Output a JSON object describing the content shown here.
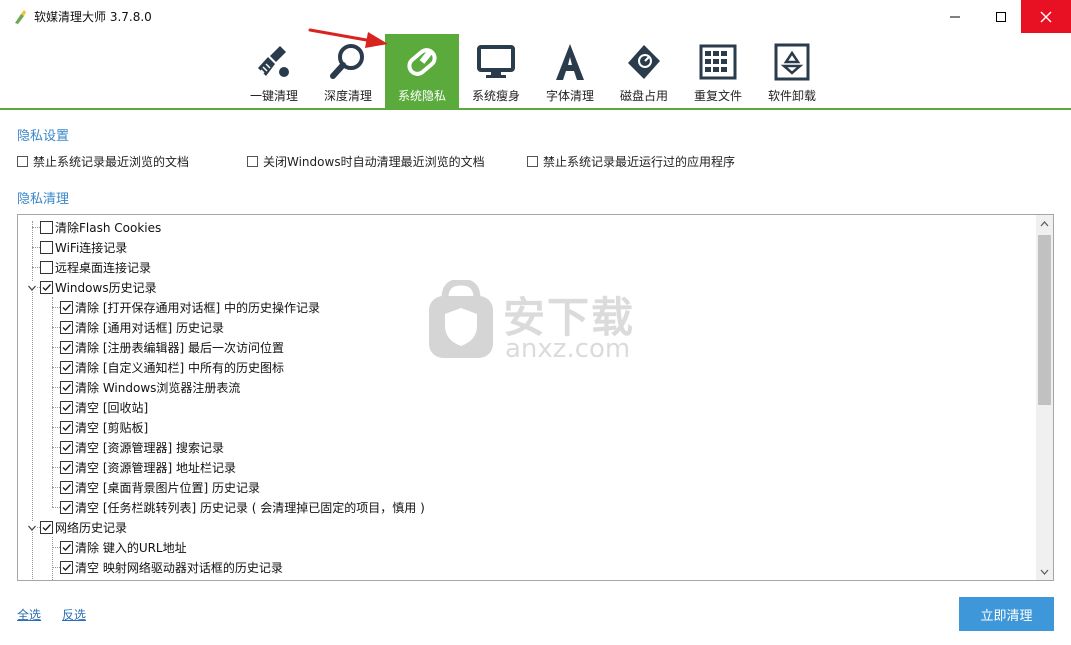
{
  "window": {
    "title": "软媒清理大师 3.7.8.0"
  },
  "toolbar": {
    "tabs": [
      {
        "label": "一键清理",
        "icon": "broom-icon"
      },
      {
        "label": "深度清理",
        "icon": "magnifier-icon"
      },
      {
        "label": "系统隐私",
        "icon": "eraser-icon",
        "active": true
      },
      {
        "label": "系统瘦身",
        "icon": "monitor-icon"
      },
      {
        "label": "字体清理",
        "icon": "font-a-icon"
      },
      {
        "label": "磁盘占用",
        "icon": "disk-tag-icon"
      },
      {
        "label": "重复文件",
        "icon": "grid-files-icon"
      },
      {
        "label": "软件卸载",
        "icon": "recycle-bin-icon"
      }
    ]
  },
  "privacy_settings": {
    "title": "隐私设置",
    "options": [
      {
        "label": "禁止系统记录最近浏览的文档",
        "checked": false
      },
      {
        "label": "关闭Windows时自动清理最近浏览的文档",
        "checked": false
      },
      {
        "label": "禁止系统记录最近运行过的应用程序",
        "checked": false
      }
    ]
  },
  "privacy_clean": {
    "title": "隐私清理",
    "items": [
      {
        "label": "清除Flash Cookies",
        "checked": false,
        "level": 0
      },
      {
        "label": "WiFi连接记录",
        "checked": false,
        "level": 0
      },
      {
        "label": "远程桌面连接记录",
        "checked": false,
        "level": 0
      },
      {
        "label": "Windows历史记录",
        "checked": true,
        "level": 0,
        "expanded": true
      },
      {
        "label": "清除 [打开保存通用对话框] 中的历史操作记录",
        "checked": true,
        "level": 1
      },
      {
        "label": "清除 [通用对话框] 历史记录",
        "checked": true,
        "level": 1
      },
      {
        "label": "清除 [注册表编辑器] 最后一次访问位置",
        "checked": true,
        "level": 1
      },
      {
        "label": "清除 [自定义通知栏] 中所有的历史图标",
        "checked": true,
        "level": 1
      },
      {
        "label": "清除 Windows浏览器注册表流",
        "checked": true,
        "level": 1
      },
      {
        "label": "清空 [回收站]",
        "checked": true,
        "level": 1
      },
      {
        "label": "清空 [剪贴板]",
        "checked": true,
        "level": 1
      },
      {
        "label": "清空 [资源管理器] 搜索记录",
        "checked": true,
        "level": 1
      },
      {
        "label": "清空 [资源管理器] 地址栏记录",
        "checked": true,
        "level": 1
      },
      {
        "label": "清空 [桌面背景图片位置] 历史记录",
        "checked": true,
        "level": 1
      },
      {
        "label": "清空 [任务栏跳转列表] 历史记录 ( 会清理掉已固定的项目，慎用 )",
        "checked": true,
        "level": 1
      },
      {
        "label": "网络历史记录",
        "checked": true,
        "level": 0,
        "expanded": true
      },
      {
        "label": "清除 键入的URL地址",
        "checked": true,
        "level": 1
      },
      {
        "label": "清空 映射网络驱动器对话框的历史记录",
        "checked": true,
        "level": 1
      }
    ]
  },
  "watermark": {
    "text": "安下载",
    "sub": "anxz.com"
  },
  "footer": {
    "select_all": "全选",
    "invert": "反选",
    "clean_now": "立即清理"
  },
  "colors": {
    "accent_green": "#5aaa3c",
    "link_blue": "#3a87c8",
    "button_blue": "#3d97d9",
    "close_red": "#e81123"
  }
}
